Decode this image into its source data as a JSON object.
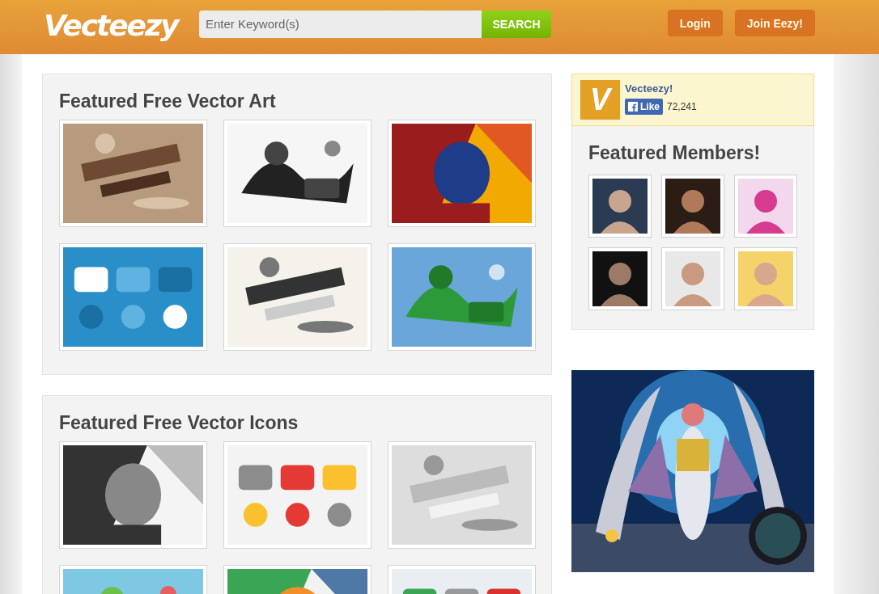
{
  "header": {
    "logo": "Vecteezy",
    "search": {
      "placeholder": "Enter Keyword(s)",
      "button": "SEARCH"
    },
    "buttons": [
      "Login",
      "Join Eezy!"
    ]
  },
  "sections": [
    {
      "title": "Featured Free Vector Art"
    },
    {
      "title": "Featured Free Vector Icons"
    }
  ],
  "facebook": {
    "logo_letter": "V",
    "page_name": "Vecteezy!",
    "like_button": "Like",
    "like_count": "72,241"
  },
  "members": {
    "title": "Featured Members!",
    "avatars": [
      {
        "kind": "avatar"
      },
      {
        "kind": "avatar"
      },
      {
        "kind": "avatar"
      },
      {
        "kind": "avatar"
      },
      {
        "kind": "avatar"
      },
      {
        "kind": "avatar"
      }
    ]
  }
}
